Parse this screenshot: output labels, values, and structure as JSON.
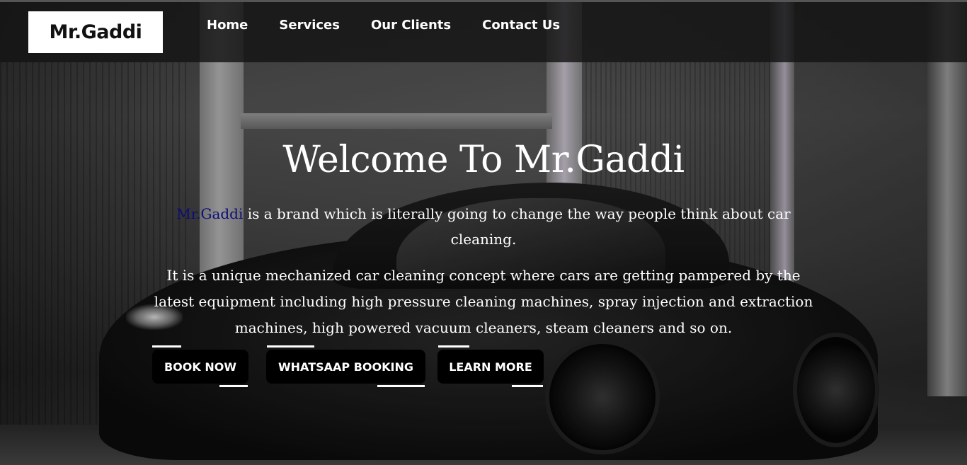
{
  "brand": {
    "logo_text": "Mr.Gaddi"
  },
  "nav": {
    "items": [
      {
        "label": "Home"
      },
      {
        "label": "Services"
      },
      {
        "label": "Our Clients"
      },
      {
        "label": "Contact Us"
      }
    ]
  },
  "hero": {
    "title": "Welcome To Mr.Gaddi",
    "intro_brand": "Mr.Gaddi",
    "intro_rest": " is a brand which is literally going to change the way people think about car cleaning.",
    "description": "It is a unique mechanized car cleaning concept where cars are getting pampered by the latest equipment including high pressure cleaning machines, spray injection and extraction machines, high powered vacuum cleaners, steam cleaners and so on.",
    "buttons": {
      "book_now": "BOOK NOW",
      "whatsapp": "WHATSAAP BOOKING",
      "learn_more": "LEARN MORE"
    }
  },
  "colors": {
    "header_bg": "#141414",
    "button_bg": "#000000",
    "brand_link": "#0c0c7a",
    "text": "#ffffff"
  }
}
